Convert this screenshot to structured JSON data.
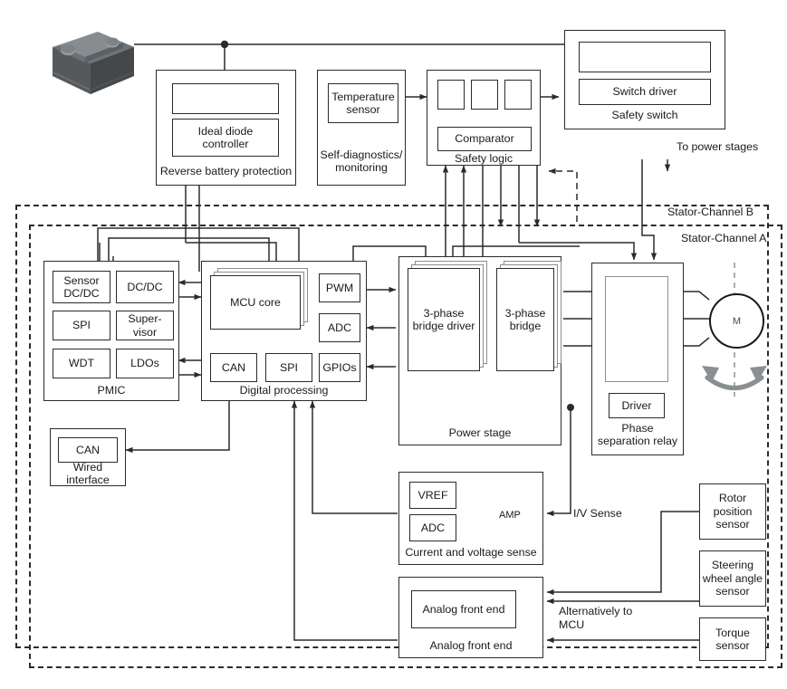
{
  "diagram": {
    "title": "Automotive EPS (electric power steering) system block diagram",
    "channels": {
      "channel_b_label": "Stator-Channel B",
      "channel_a_label": "Stator-Channel A"
    },
    "blocks": {
      "battery": {
        "icon": "car-battery-icon"
      },
      "reverse_battery_protection": {
        "label": "Reverse battery protection",
        "children": [
          {
            "label": ""
          },
          {
            "label": "Ideal diode\ncontroller"
          }
        ]
      },
      "self_diagnostics": {
        "label": "Self-diagnostics/\nmonitoring",
        "children": [
          {
            "label": "Temperature\nsensor"
          }
        ]
      },
      "safety_logic": {
        "label": "Safety logic",
        "gates": [
          "and-gate-icon",
          "and-gate-icon",
          "buffer-gate-icon"
        ],
        "children": [
          {
            "label": "Comparator"
          }
        ]
      },
      "safety_switch": {
        "label": "Safety switch",
        "children": [
          {
            "label": ""
          },
          {
            "label": "Switch driver"
          }
        ]
      },
      "to_power_stages": {
        "label": "To power stages"
      },
      "pmic": {
        "label": "PMIC",
        "children": [
          {
            "label": "Sensor\nDC/DC"
          },
          {
            "label": "DC/DC"
          },
          {
            "label": "SPI"
          },
          {
            "label": "Super-\nvisor"
          },
          {
            "label": "WDT"
          },
          {
            "label": "LDOs"
          }
        ]
      },
      "digital_processing": {
        "label": "Digital processing",
        "children": [
          {
            "label": "MCU core"
          },
          {
            "label": "PWM"
          },
          {
            "label": "ADC"
          },
          {
            "label": "CAN"
          },
          {
            "label": "SPI"
          },
          {
            "label": "GPIOs"
          }
        ]
      },
      "wired_interface": {
        "label": "Wired interface",
        "children": [
          {
            "label": "CAN"
          }
        ]
      },
      "power_stage": {
        "label": "Power stage",
        "children": [
          {
            "label": "3-phase\nbridge driver"
          },
          {
            "label": "3-phase\nbridge"
          }
        ],
        "symbols": [
          "mosfet-icon",
          "mosfet-icon",
          "shunt-resistor-icon",
          "ground-icon",
          "shunt-switch-icon"
        ]
      },
      "phase_separation_relay": {
        "label": "Phase\nseparation relay",
        "children": [
          {
            "label": ""
          },
          {
            "label": "Driver"
          }
        ]
      },
      "motor": {
        "label": "M",
        "icon": "motor-icon",
        "rotation_icon": "bidirectional-rotation-arrow-icon"
      },
      "current_voltage_sense": {
        "label": "Current and voltage sense",
        "children": [
          {
            "label": "VREF"
          },
          {
            "label": "ADC"
          },
          {
            "label": "AMP"
          }
        ]
      },
      "analog_front_end": {
        "label": "Analog front end",
        "children": [
          {
            "label": "Analog front end"
          }
        ]
      },
      "rotor_position_sensor": {
        "label": "Rotor\nposition\nsensor"
      },
      "steering_wheel_angle_sensor": {
        "label": "Steering\nwheel angle\nsensor"
      },
      "torque_sensor": {
        "label": "Torque\nsensor"
      }
    },
    "annotations": {
      "iv_sense": "I/V Sense",
      "alternatively_to_mcu": "Alternatively to\nMCU"
    },
    "colors": {
      "line": "#2b2b2b",
      "line_gray": "#8d8d8d",
      "battery_dark": "#4d5154",
      "battery_mid": "#6b7074",
      "battery_light": "#8a9095",
      "background": "#ffffff"
    }
  }
}
